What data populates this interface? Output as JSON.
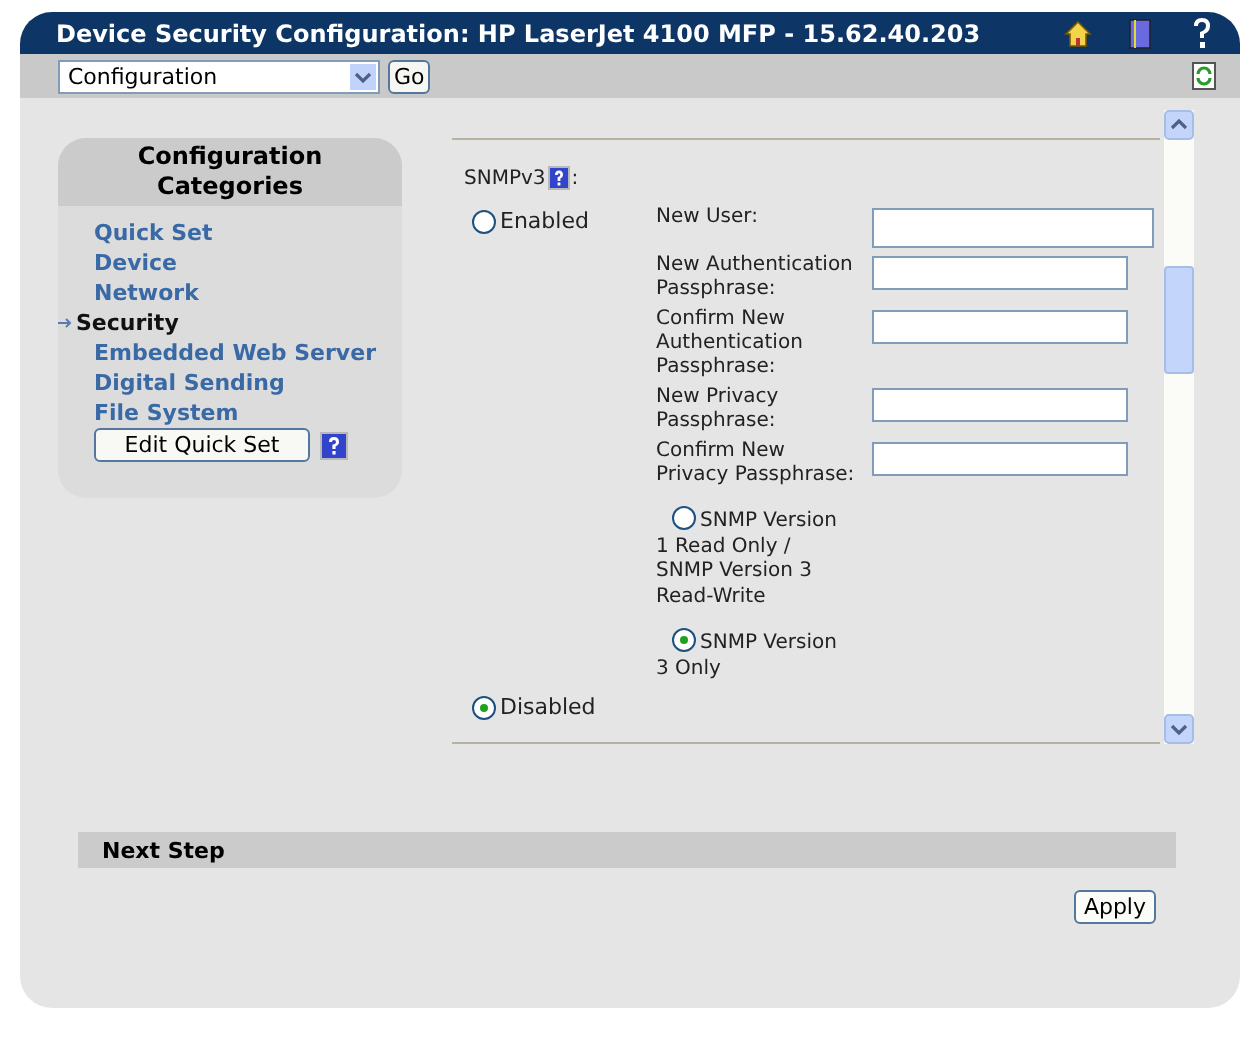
{
  "window": {
    "title": "Device Security Configuration: HP LaserJet 4100 MFP - 15.62.40.203"
  },
  "toolbar": {
    "dropdown": "Configuration",
    "go_button": "Go"
  },
  "sidebar": {
    "heading": "Configuration Categories",
    "items": [
      {
        "label": "Quick Set",
        "selected": false
      },
      {
        "label": "Device",
        "selected": false
      },
      {
        "label": "Network",
        "selected": false
      },
      {
        "label": "Security",
        "selected": true
      },
      {
        "label": "Embedded Web Server",
        "selected": false
      },
      {
        "label": "Digital Sending",
        "selected": false
      },
      {
        "label": "File System",
        "selected": false
      }
    ],
    "edit_button": "Edit Quick Set"
  },
  "snmpv3": {
    "label": "SNMPv3",
    "suffix": ":",
    "enabled": {
      "label": "Enabled",
      "selected": false
    },
    "fields": [
      {
        "label": "New User:"
      },
      {
        "label": "New Authentication Passphrase:"
      },
      {
        "label": "Confirm New Authentication Passphrase:"
      },
      {
        "label": "New Privacy Passphrase:"
      },
      {
        "label": "Confirm New Privacy Passphrase:"
      }
    ],
    "versions": [
      {
        "label": "SNMP Version 1 Read Only / SNMP Version 3 Read-Write",
        "selected": false
      },
      {
        "label": "SNMP Version 3 Only",
        "selected": true
      }
    ],
    "disabled": {
      "label": "Disabled",
      "selected": true
    }
  },
  "next_step": {
    "heading": "Next Step"
  },
  "apply_button": "Apply"
}
